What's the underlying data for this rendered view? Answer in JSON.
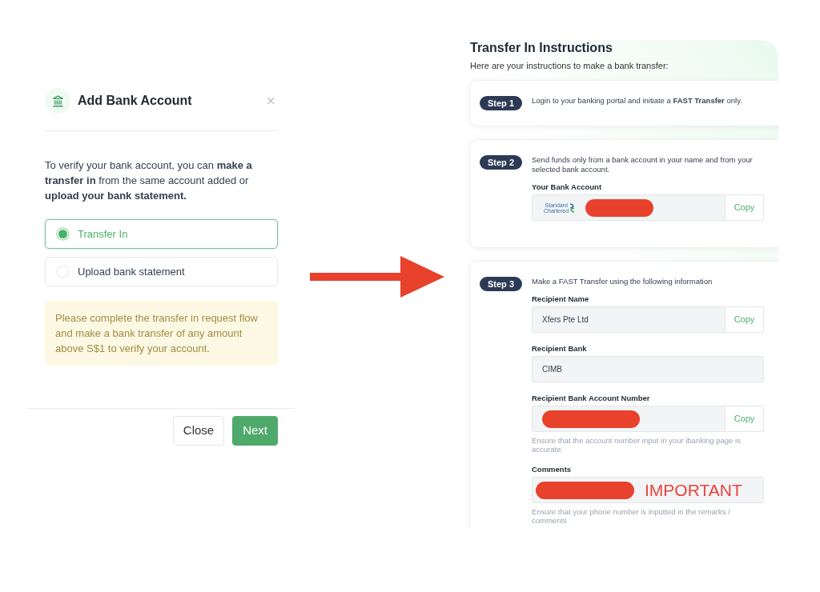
{
  "add_bank_account_dialog": {
    "title": "Add Bank Account",
    "description": "To verify your bank account, you can **make a transfer in** from the same account added or **upload your bank statement.**",
    "options": [
      {
        "label": "Transfer In",
        "selected": true
      },
      {
        "label": "Upload bank statement",
        "selected": false
      }
    ],
    "notice": "Please complete the transfer in request flow and make a bank transfer of any amount above S$1 to verify your account.",
    "buttons": [
      {
        "label": "Close",
        "kind": "secondary"
      },
      {
        "label": "Next",
        "kind": "primary"
      }
    ]
  },
  "transfer_in_instructions": {
    "title": "Transfer In Instructions",
    "subtitle": "Here are your instructions to make a bank transfer:",
    "steps": [
      {
        "badge": "Step 1",
        "text": "Login to your banking portal and initiate a **FAST Transfer** only."
      },
      {
        "badge": "Step 2",
        "text": "Send funds only from a bank account in your name and from your selected bank account.",
        "fields": [
          {
            "label": "Your Bank Account",
            "bank_logo": "Standard Chartered",
            "redacted": true,
            "copy_button": "Copy"
          }
        ]
      },
      {
        "badge": "Step 3",
        "text": "Make a FAST Transfer using the following information",
        "fields": [
          {
            "label": "Recipient Name",
            "value": "Xfers Pte Ltd",
            "redacted": false,
            "copy_button": "Copy"
          },
          {
            "label": "Recipient Bank",
            "value": "CIMB",
            "redacted": false
          },
          {
            "label": "Recipient Bank Account Number",
            "redacted": true,
            "copy_button": "Copy",
            "hint": "Ensure that the account number input in your ibanking page is accurate."
          },
          {
            "label": "Comments",
            "redacted": true,
            "annotation": "IMPORTANT",
            "hint": "Ensure that your phone number is inputted in the remarks / comments"
          }
        ]
      }
    ]
  }
}
